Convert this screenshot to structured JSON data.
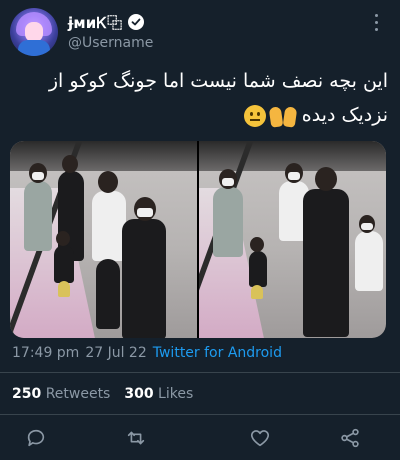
{
  "user": {
    "display_name": "ɉᴍᴎᏦ⿻",
    "handle": "@Username",
    "avatar_icon": "avatar"
  },
  "tweet": {
    "text_line1": "این بچه نصف شما نیست اما جونگ کوکو از",
    "text_line2": "نزدیک دیده"
  },
  "media": {
    "photos": [
      "photo-left",
      "photo-right"
    ]
  },
  "meta": {
    "time": "17:49 pm",
    "date": "27 Jul 22",
    "source": "Twitter for Android"
  },
  "stats": {
    "retweets_count": "250",
    "retweets_label": "Retweets",
    "likes_count": "300",
    "likes_label": "Likes"
  },
  "actions": {
    "icons": [
      "reply-icon",
      "retweet-icon",
      "like-icon",
      "share-icon"
    ]
  },
  "colors": {
    "background": "#15202b",
    "link": "#1d9bf0",
    "muted": "#8b98a5",
    "divider": "#38444d"
  }
}
